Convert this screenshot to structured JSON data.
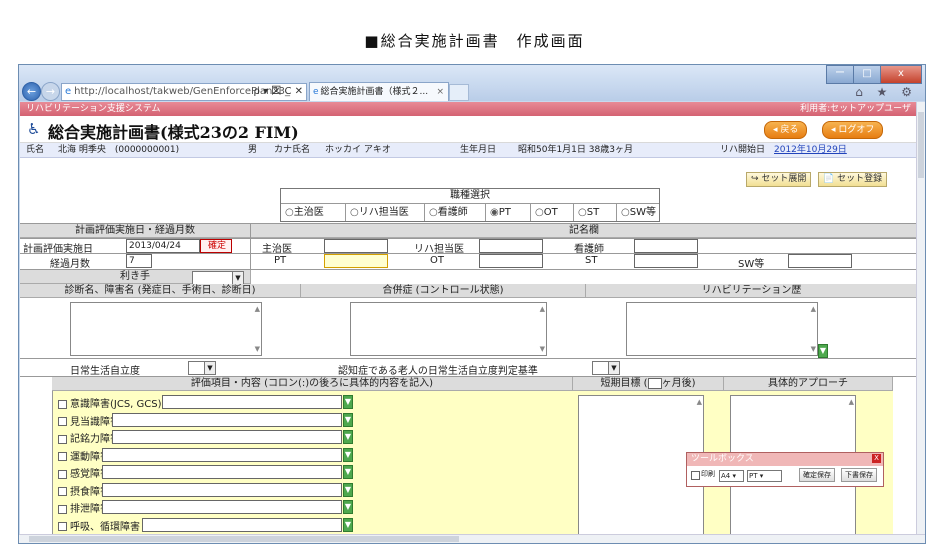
{
  "doc_title": "■総合実施計画書　作成画面",
  "browser": {
    "url": "http://localhost/takweb/GenEnforcePlan23_",
    "url_tools": "ρ ▾ 図 C ✕",
    "tab_title": "総合実施計画書（様式２...",
    "tab_close": "×",
    "window_controls": [
      "ー",
      "□",
      "x"
    ],
    "right_icons": "⌂ ★ ⚙"
  },
  "app": {
    "system_name": "リハビリテーション支援システム",
    "user_label": "利用者:セットアップユーザ",
    "title": "総合実施計画書(様式23の2 FIM)",
    "back_button": "戻る",
    "logoff_button": "ログオフ"
  },
  "patient": {
    "name_label": "氏名",
    "name_value": "北海 明季央　(0000000001)",
    "sex": "男",
    "kana_label": "カナ氏名",
    "kana_value": "ホッカイ アキオ",
    "birth_label": "生年月日",
    "birth_value": "昭和50年1月1日 38歳3ヶ月",
    "rehab_start_label": "リハ開始日",
    "rehab_start_value": "2012年10月29日"
  },
  "set_buttons": {
    "expand": "セット展開",
    "register": "セット登録"
  },
  "job_select": {
    "header": "職種選択",
    "options": [
      "主治医",
      "リハ担当医",
      "看護師",
      "PT",
      "OT",
      "ST",
      "SW等"
    ],
    "selected": "PT"
  },
  "plan": {
    "eval_header": "計画評価実施日・経過月数",
    "signature_header": "記名欄",
    "eval_date_label": "計画評価実施日",
    "eval_date_value": "2013/04/24",
    "confirm_button": "確定",
    "months_label": "経過月数",
    "months_value": "7",
    "roles_row1": [
      "主治医",
      "リハ担当医",
      "看護師"
    ],
    "roles_row2": [
      "PT",
      "OT",
      "ST",
      "SW等"
    ]
  },
  "handedness_label": "利き手",
  "history_headers": {
    "diagnosis": "診断名、障害名 (発症日、手術日、診断日)",
    "complication": "合併症 (コントロール状態)",
    "rehab_history": "リハビリテーション歴"
  },
  "independence_label": "日常生活自立度",
  "dementia_label": "認知症である老人の日常生活自立度判定基準",
  "eval_headers": {
    "items": "評価項目・内容 (コロン(:)の後ろに具体的内容を記入)",
    "short_goal_prefix": "短期目標 (",
    "short_goal_suffix": "ヶ月後)",
    "approach": "具体的アプローチ"
  },
  "eval_items": [
    "意識障害(JCS, GCS) :",
    "見当識障害 :",
    "記銘力障害 :",
    "運動障害 :",
    "感覚障害 :",
    "摂食障害 :",
    "排泄障害 :",
    "呼吸、循環障害 :"
  ],
  "toolbox": {
    "title": "ツールボックス",
    "close": "X",
    "print_label": "印刷",
    "paper_value": "A4",
    "role_value": "PT",
    "confirm_save": "確定保存",
    "draft_save": "下書保存"
  }
}
